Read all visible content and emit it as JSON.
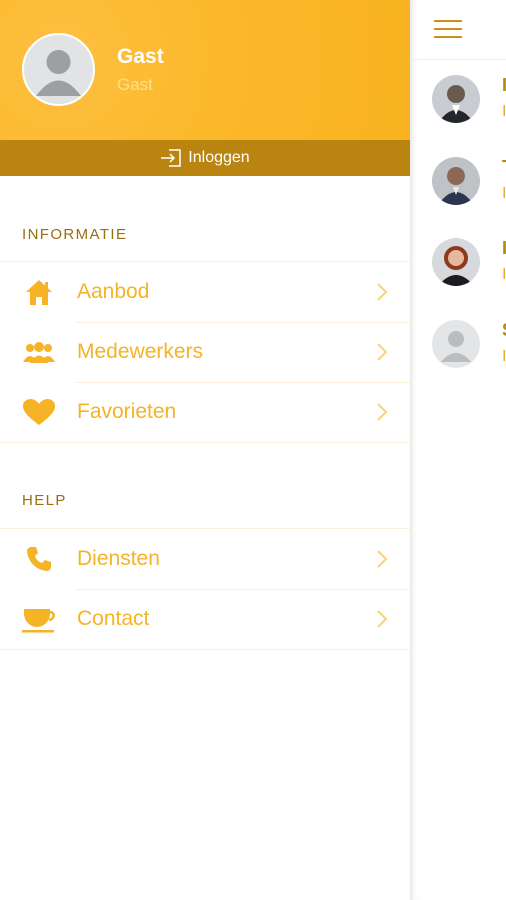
{
  "drawer": {
    "user": {
      "name": "Gast",
      "subtitle": "Gast"
    },
    "login_label": "Inloggen",
    "sections": [
      {
        "title": "INFORMATIE",
        "items": [
          {
            "label": "Aanbod",
            "icon": "home-icon"
          },
          {
            "label": "Medewerkers",
            "icon": "people-icon"
          },
          {
            "label": "Favorieten",
            "icon": "heart-icon"
          }
        ]
      },
      {
        "title": "HELP",
        "items": [
          {
            "label": "Diensten",
            "icon": "phone-icon"
          },
          {
            "label": "Contact",
            "icon": "coffee-cup-icon"
          }
        ]
      }
    ]
  },
  "background_list": {
    "employees": [
      {
        "name_initial": "I",
        "role_initial": "I"
      },
      {
        "name_initial": "T",
        "role_initial": "I"
      },
      {
        "name_initial": "I",
        "role_initial": "I"
      },
      {
        "name_initial": "S",
        "role_initial": "I"
      }
    ]
  },
  "colors": {
    "accent": "#f9b321",
    "accent_dark": "#b98510",
    "label": "#f6b325",
    "section_title": "#9a6d12"
  }
}
